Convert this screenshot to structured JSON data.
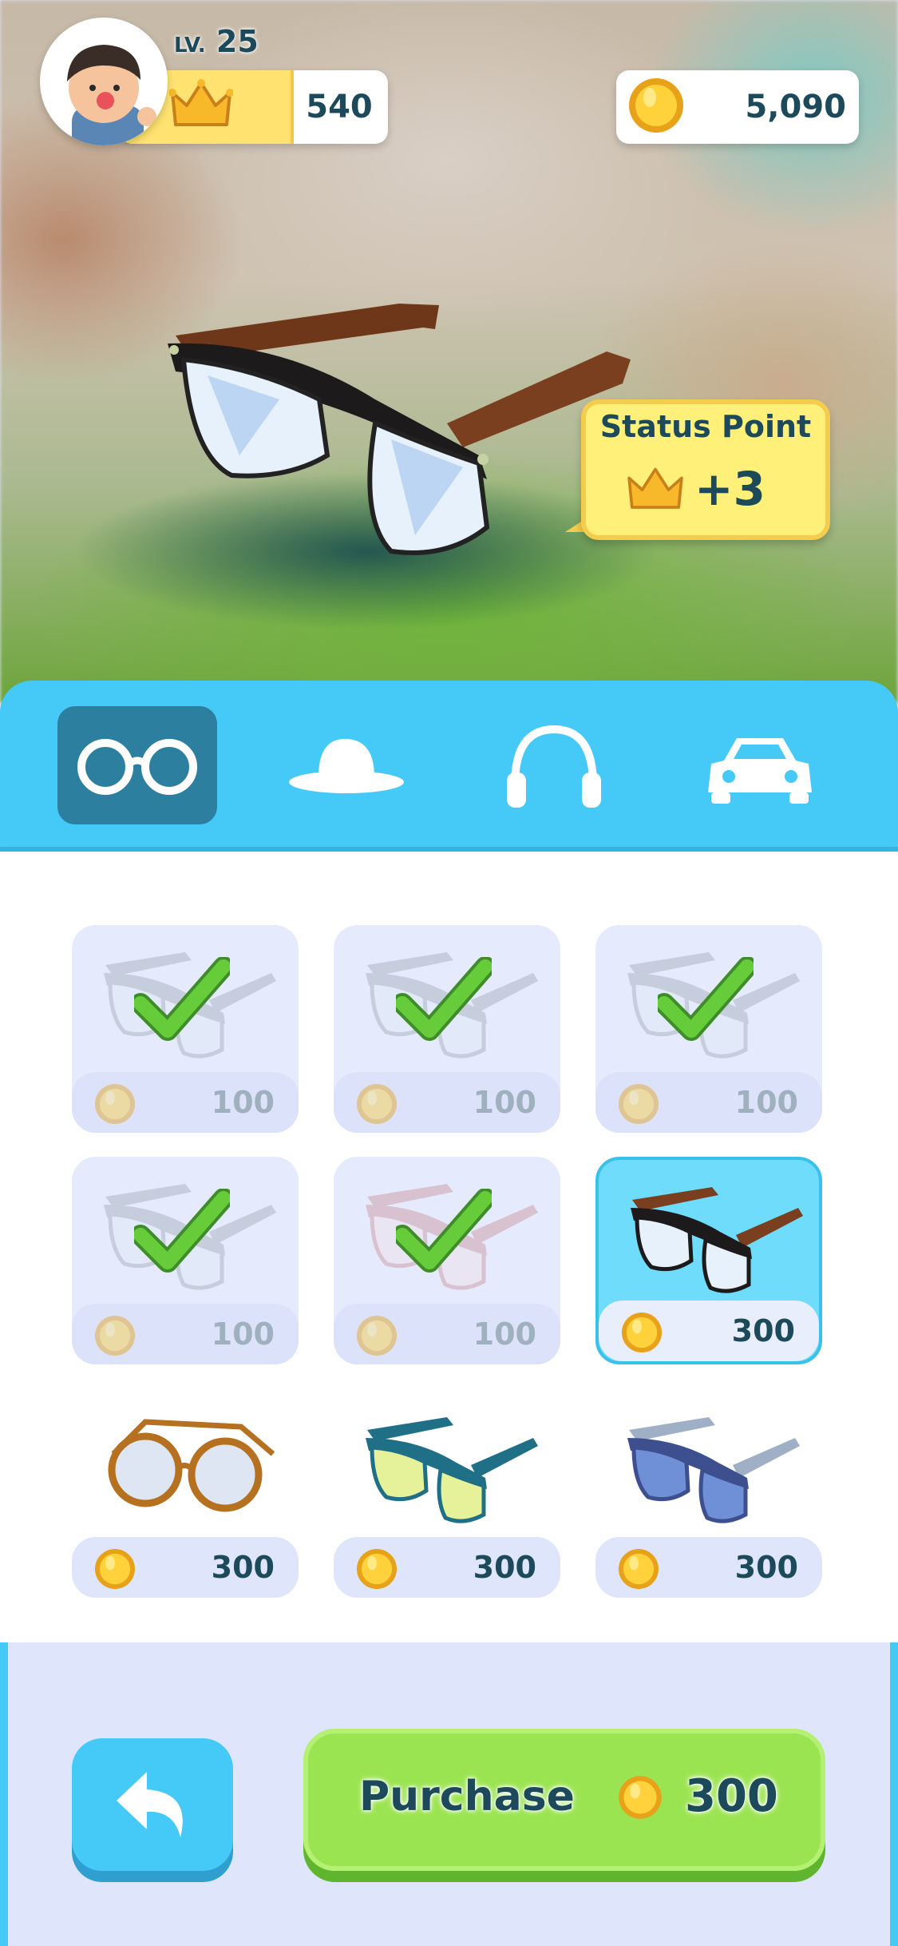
{
  "hud": {
    "level_prefix": "LV.",
    "level": "25",
    "status_points": "540",
    "coins": "5,090"
  },
  "preview": {
    "bubble_title": "Status Point",
    "bubble_value": "+3"
  },
  "tabs": [
    {
      "name": "glasses",
      "icon": "glasses-icon",
      "active": true
    },
    {
      "name": "hats",
      "icon": "hat-icon",
      "active": false
    },
    {
      "name": "headphones",
      "icon": "headphones-icon",
      "active": false
    },
    {
      "name": "cars",
      "icon": "car-icon",
      "active": false
    }
  ],
  "items": [
    {
      "price": "100",
      "state": "owned"
    },
    {
      "price": "100",
      "state": "owned"
    },
    {
      "price": "100",
      "state": "owned"
    },
    {
      "price": "100",
      "state": "owned"
    },
    {
      "price": "100",
      "state": "owned"
    },
    {
      "price": "300",
      "state": "selected"
    },
    {
      "price": "300",
      "state": "available"
    },
    {
      "price": "300",
      "state": "available"
    },
    {
      "price": "300",
      "state": "available"
    }
  ],
  "footer": {
    "purchase_label": "Purchase",
    "purchase_price": "300"
  },
  "colors": {
    "accent_blue": "#45c9f7",
    "purchase_green": "#9be451",
    "text_dark": "#1d4a5a",
    "bubble_yellow": "#fff07a"
  }
}
